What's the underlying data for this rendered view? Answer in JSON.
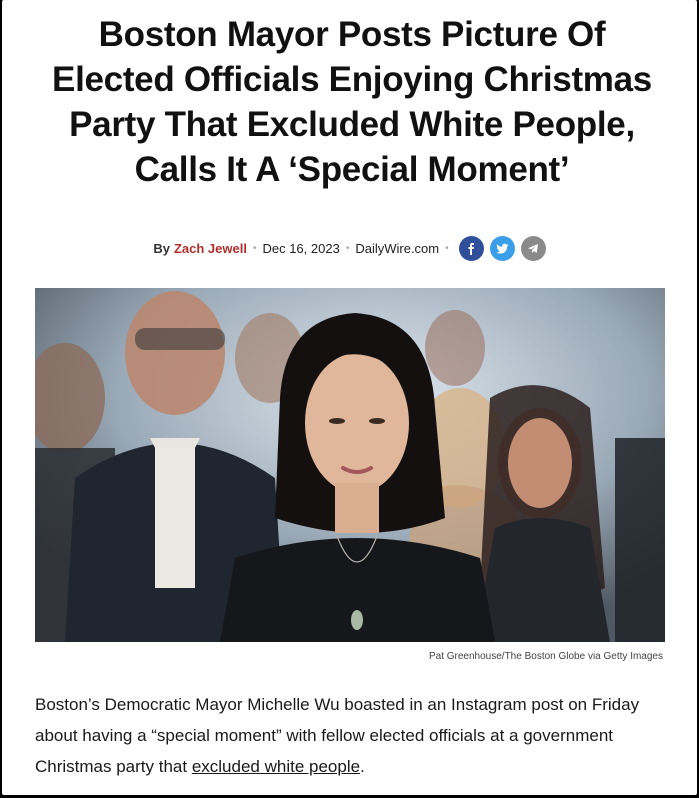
{
  "article": {
    "headline": "Boston Mayor Posts Picture Of Elected Officials Enjoying Christmas Party That Excluded White People, Calls It A ‘Special Moment’",
    "byline": {
      "by": "By",
      "author": "Zach Jewell",
      "date": "Dec 16, 2023",
      "site": "DailyWire.com"
    },
    "share_icons": [
      "facebook-icon",
      "twitter-icon",
      "telegram-icon"
    ],
    "photo_credit": "Pat Greenhouse/The Boston Globe via Getty Images",
    "body": {
      "before_link": "Boston’s Democratic Mayor Michelle Wu boasted in an Instagram post on Friday about having a “special moment” with fellow elected officials at a government Christmas party that ",
      "link_text": "excluded white people",
      "after_link": "."
    }
  },
  "colors": {
    "author": "#b0302c",
    "facebook": "#2f4f9a",
    "twitter": "#3a9ee8",
    "telegram": "#8a8a8a"
  }
}
